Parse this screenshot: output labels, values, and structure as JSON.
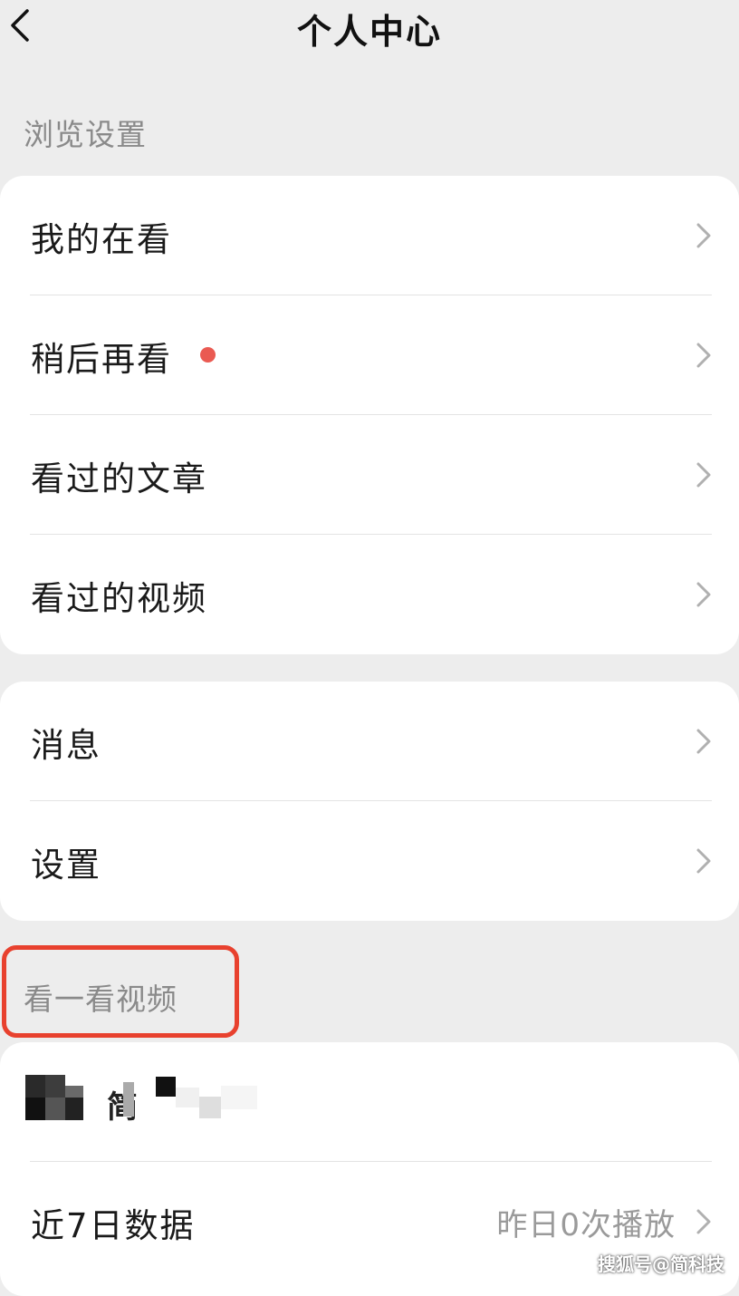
{
  "header": {
    "title": "个人中心",
    "back_icon": "chevron-left-icon"
  },
  "sections": {
    "browse_label": "浏览设置",
    "video_label": "看一看视频"
  },
  "browse_items": [
    {
      "label": "我的在看"
    },
    {
      "label": "稍后再看",
      "has_badge_dot": true
    },
    {
      "label": "看过的文章"
    },
    {
      "label": "看过的视频"
    }
  ],
  "misc_items": [
    {
      "label": "消息"
    },
    {
      "label": "设置"
    }
  ],
  "video_card": {
    "account_name_glyph": "简",
    "stats_label": "近7日数据",
    "stats_value": "昨日0次播放"
  },
  "watermark": "搜狐号@简科技",
  "colors": {
    "background": "#ededed",
    "badge_dot": "#ea5a52",
    "highlight_box": "#e8412e"
  }
}
